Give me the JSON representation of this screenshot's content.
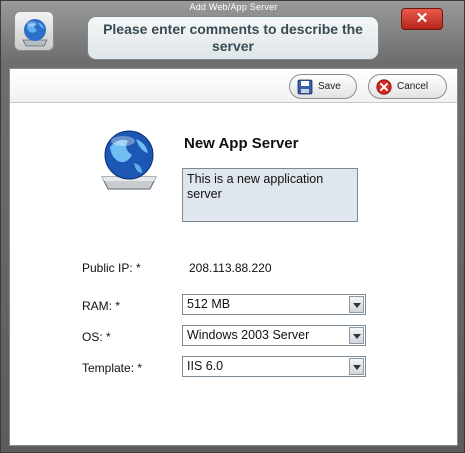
{
  "window": {
    "title": "Add Web/App Server"
  },
  "banner": {
    "text": "Please enter comments to describe the server"
  },
  "toolbar": {
    "save_label": "Save",
    "cancel_label": "Cancel"
  },
  "form": {
    "name": "New App Server",
    "description": "This is a new application server",
    "public_ip_label": "Public IP:  *",
    "public_ip_value": "208.113.88.220",
    "ram_label": "RAM:  *",
    "ram_value": "512 MB",
    "os_label": "OS:  *",
    "os_value": "Windows 2003 Server",
    "template_label": "Template:  *",
    "template_value": "IIS 6.0"
  },
  "icons": {
    "header": "globe-server-icon",
    "main": "globe-server-icon",
    "save": "floppy-disk-icon",
    "cancel": "cancel-x-icon",
    "close": "close-icon"
  }
}
